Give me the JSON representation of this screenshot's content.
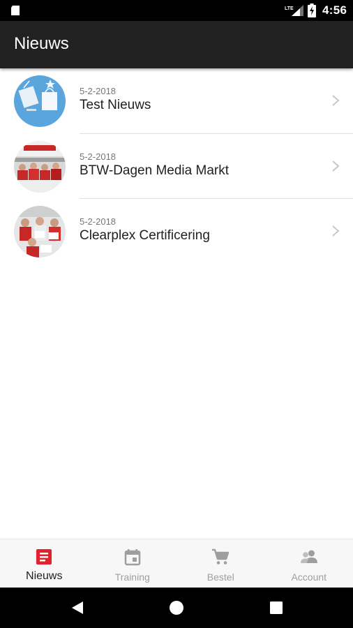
{
  "status_bar": {
    "time": "4:56",
    "network": "LTE",
    "icons": [
      "sd-card-icon",
      "lte-signal-icon",
      "battery-charging-icon"
    ]
  },
  "app_bar": {
    "title": "Nieuws"
  },
  "news": [
    {
      "date": "5-2-2018",
      "title": "Test Nieuws",
      "thumbnail": "gift-bags-image"
    },
    {
      "date": "5-2-2018",
      "title": "BTW-Dagen Media Markt",
      "thumbnail": "store-team-image"
    },
    {
      "date": "5-2-2018",
      "title": "Clearplex Certificering",
      "thumbnail": "certificate-group-image"
    }
  ],
  "bottom_nav": [
    {
      "label": "Nieuws",
      "icon": "news-icon",
      "active": true
    },
    {
      "label": "Training",
      "icon": "calendar-icon",
      "active": false
    },
    {
      "label": "Bestel",
      "icon": "cart-icon",
      "active": false
    },
    {
      "label": "Account",
      "icon": "account-icon",
      "active": false
    }
  ],
  "colors": {
    "accent": "#e5202e",
    "app_bar": "#212121",
    "inactive": "#9e9e9e"
  }
}
